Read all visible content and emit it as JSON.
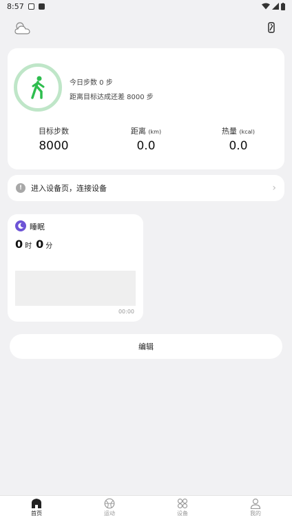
{
  "status_bar": {
    "time": "8:57"
  },
  "summary": {
    "today_steps_text": "今日步数 0 步",
    "goal_remaining_text": "距离目标达成还差 8000 步",
    "stats": [
      {
        "label": "目标步数",
        "unit": "",
        "value": "8000"
      },
      {
        "label": "距离",
        "unit": "(km)",
        "value": "0.0"
      },
      {
        "label": "热量",
        "unit": "(kcal)",
        "value": "0.0"
      }
    ]
  },
  "connect_banner": {
    "text": "进入设备页，连接设备"
  },
  "sleep": {
    "title": "睡眠",
    "hours": "0",
    "hours_unit": "时",
    "minutes": "0",
    "minutes_unit": "分",
    "time_label": "00:00"
  },
  "edit_label": "编辑",
  "tabs": [
    {
      "label": "首页",
      "active": true,
      "icon": "home-icon"
    },
    {
      "label": "运动",
      "active": false,
      "icon": "sport-icon"
    },
    {
      "label": "设备",
      "active": false,
      "icon": "device-icon"
    },
    {
      "label": "我的",
      "active": false,
      "icon": "profile-icon"
    }
  ],
  "colors": {
    "accent_green": "#2ebd4e",
    "ring_light": "#bfe6c8",
    "sleep_purple": "#6d54d6"
  }
}
